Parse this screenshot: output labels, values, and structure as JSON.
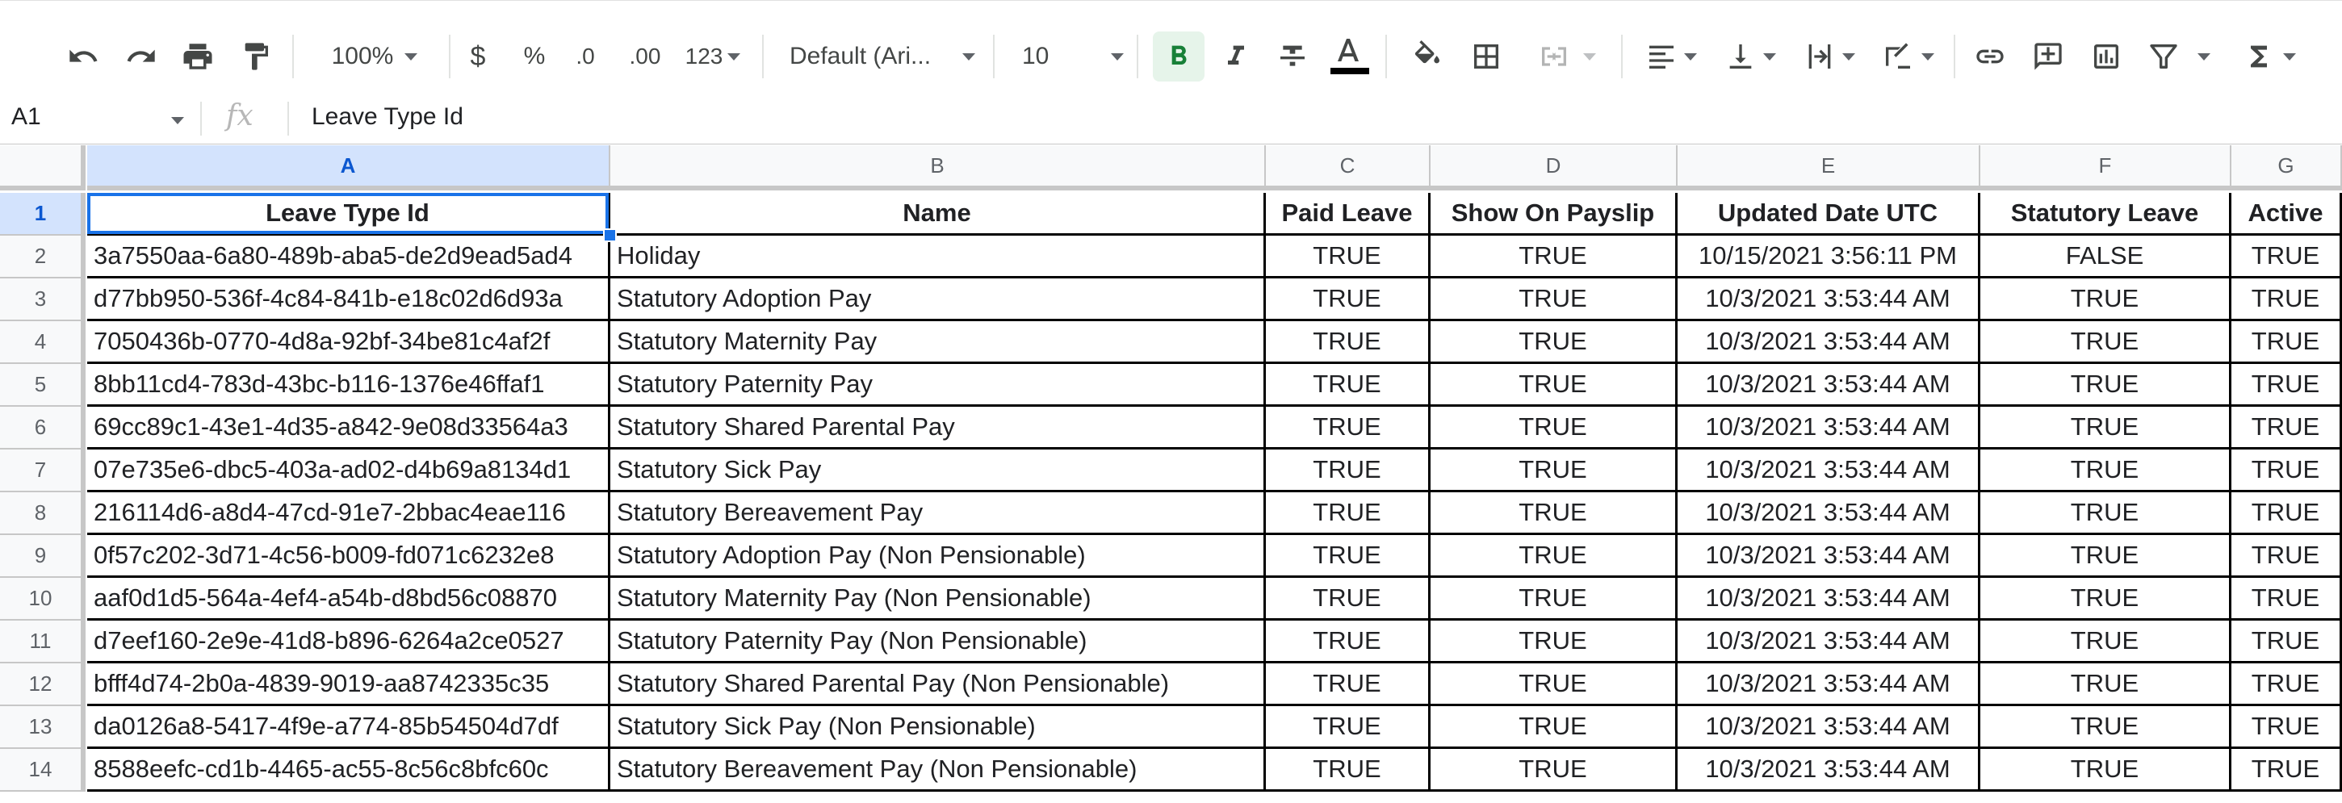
{
  "toolbar": {
    "zoom": "100%",
    "currency": "$",
    "percent": "%",
    "decrease_decimals": ".0",
    "increase_decimals": ".00",
    "more_formats": "123",
    "font": "Default (Ari...",
    "font_size": "10",
    "icons": [
      "undo-icon",
      "redo-icon",
      "print-icon",
      "paint-format-icon",
      "bold-icon",
      "italic-icon",
      "strikethrough-icon",
      "text-color-icon",
      "fill-color-icon",
      "borders-icon",
      "merge-cells-icon",
      "horizontal-align-icon",
      "vertical-align-icon",
      "text-wrapping-icon",
      "text-rotation-icon",
      "insert-link-icon",
      "insert-comment-icon",
      "insert-chart-icon",
      "filter-icon",
      "functions-icon"
    ],
    "text_color": "#000000",
    "bold_active_color": "#188038"
  },
  "formula_bar": {
    "cell_ref": "A1",
    "fx": "fx",
    "content": "Leave Type Id"
  },
  "sheet": {
    "column_letters": [
      "A",
      "B",
      "C",
      "D",
      "E",
      "F",
      "G"
    ],
    "headers": [
      "Leave Type Id",
      "Name",
      "Paid Leave",
      "Show On Payslip",
      "Updated Date UTC",
      "Statutory Leave",
      "Active"
    ],
    "rows": [
      {
        "n": "2",
        "id": "3a7550aa-6a80-489b-aba5-de2d9ead5ad4",
        "name": "Holiday",
        "paid": "TRUE",
        "payslip": "TRUE",
        "updated": "10/15/2021 3:56:11 PM",
        "statutory": "FALSE",
        "active": "TRUE"
      },
      {
        "n": "3",
        "id": "d77bb950-536f-4c84-841b-e18c02d6d93a",
        "name": "Statutory Adoption Pay",
        "paid": "TRUE",
        "payslip": "TRUE",
        "updated": "10/3/2021 3:53:44 AM",
        "statutory": "TRUE",
        "active": "TRUE"
      },
      {
        "n": "4",
        "id": "7050436b-0770-4d8a-92bf-34be81c4af2f",
        "name": "Statutory Maternity Pay",
        "paid": "TRUE",
        "payslip": "TRUE",
        "updated": "10/3/2021 3:53:44 AM",
        "statutory": "TRUE",
        "active": "TRUE"
      },
      {
        "n": "5",
        "id": "8bb11cd4-783d-43bc-b116-1376e46ffaf1",
        "name": "Statutory Paternity Pay",
        "paid": "TRUE",
        "payslip": "TRUE",
        "updated": "10/3/2021 3:53:44 AM",
        "statutory": "TRUE",
        "active": "TRUE"
      },
      {
        "n": "6",
        "id": "69cc89c1-43e1-4d35-a842-9e08d33564a3",
        "name": "Statutory Shared Parental Pay",
        "paid": "TRUE",
        "payslip": "TRUE",
        "updated": "10/3/2021 3:53:44 AM",
        "statutory": "TRUE",
        "active": "TRUE"
      },
      {
        "n": "7",
        "id": "07e735e6-dbc5-403a-ad02-d4b69a8134d1",
        "name": "Statutory Sick Pay",
        "paid": "TRUE",
        "payslip": "TRUE",
        "updated": "10/3/2021 3:53:44 AM",
        "statutory": "TRUE",
        "active": "TRUE"
      },
      {
        "n": "8",
        "id": "216114d6-a8d4-47cd-91e7-2bbac4eae116",
        "name": "Statutory Bereavement Pay",
        "paid": "TRUE",
        "payslip": "TRUE",
        "updated": "10/3/2021 3:53:44 AM",
        "statutory": "TRUE",
        "active": "TRUE"
      },
      {
        "n": "9",
        "id": "0f57c202-3d71-4c56-b009-fd071c6232e8",
        "name": "Statutory Adoption Pay (Non Pensionable)",
        "paid": "TRUE",
        "payslip": "TRUE",
        "updated": "10/3/2021 3:53:44 AM",
        "statutory": "TRUE",
        "active": "TRUE"
      },
      {
        "n": "10",
        "id": "aaf0d1d5-564a-4ef4-a54b-d8bd56c08870",
        "name": "Statutory Maternity Pay (Non Pensionable)",
        "paid": "TRUE",
        "payslip": "TRUE",
        "updated": "10/3/2021 3:53:44 AM",
        "statutory": "TRUE",
        "active": "TRUE"
      },
      {
        "n": "11",
        "id": "d7eef160-2e9e-41d8-b896-6264a2ce0527",
        "name": "Statutory Paternity Pay (Non Pensionable)",
        "paid": "TRUE",
        "payslip": "TRUE",
        "updated": "10/3/2021 3:53:44 AM",
        "statutory": "TRUE",
        "active": "TRUE"
      },
      {
        "n": "12",
        "id": "bfff4d74-2b0a-4839-9019-aa8742335c35",
        "name": "Statutory Shared Parental Pay (Non Pensionable)",
        "paid": "TRUE",
        "payslip": "TRUE",
        "updated": "10/3/2021 3:53:44 AM",
        "statutory": "TRUE",
        "active": "TRUE"
      },
      {
        "n": "13",
        "id": "da0126a8-5417-4f9e-a774-85b54504d7df",
        "name": "Statutory Sick Pay (Non Pensionable)",
        "paid": "TRUE",
        "payslip": "TRUE",
        "updated": "10/3/2021 3:53:44 AM",
        "statutory": "TRUE",
        "active": "TRUE"
      },
      {
        "n": "14",
        "id": "8588eefc-cd1b-4465-ac55-8c56c8bfc60c",
        "name": "Statutory Bereavement Pay (Non Pensionable)",
        "paid": "TRUE",
        "payslip": "TRUE",
        "updated": "10/3/2021 3:53:44 AM",
        "statutory": "TRUE",
        "active": "TRUE"
      }
    ],
    "header_row_number": "1",
    "selection_color": "#1a73e8"
  }
}
